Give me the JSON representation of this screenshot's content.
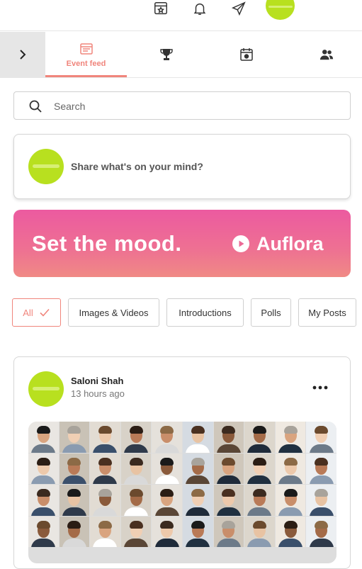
{
  "topbar": {
    "icons": [
      "calendar-star-icon",
      "bell-icon",
      "send-icon",
      "user-avatar"
    ]
  },
  "tabs": [
    {
      "name": "event-feed",
      "label": "Event feed",
      "icon": "browser-window-icon",
      "active": true
    },
    {
      "name": "leaderboard",
      "label": "",
      "icon": "trophy-icon",
      "active": false
    },
    {
      "name": "schedule",
      "label": "",
      "icon": "calendar-icon",
      "active": false
    },
    {
      "name": "people",
      "label": "",
      "icon": "people-icon",
      "active": false
    }
  ],
  "search": {
    "placeholder": "Search",
    "value": ""
  },
  "composer": {
    "prompt": "Share what's on your mind?"
  },
  "banner": {
    "headline": "Set the mood.",
    "brand": "Auflora"
  },
  "filters": [
    {
      "label": "All",
      "active": true
    },
    {
      "label": "Images & Videos",
      "active": false
    },
    {
      "label": "Introductions",
      "active": false
    },
    {
      "label": "Polls",
      "active": false
    },
    {
      "label": "My Posts",
      "active": false
    }
  ],
  "post": {
    "author": "Saloni Shah",
    "time": "13 hours ago",
    "image": "grid of participant headshots"
  },
  "colors": {
    "accent": "#f0857c",
    "avatar": "#b8e01f",
    "banner_start": "#ec5aa0",
    "banner_end": "#f08a85"
  }
}
